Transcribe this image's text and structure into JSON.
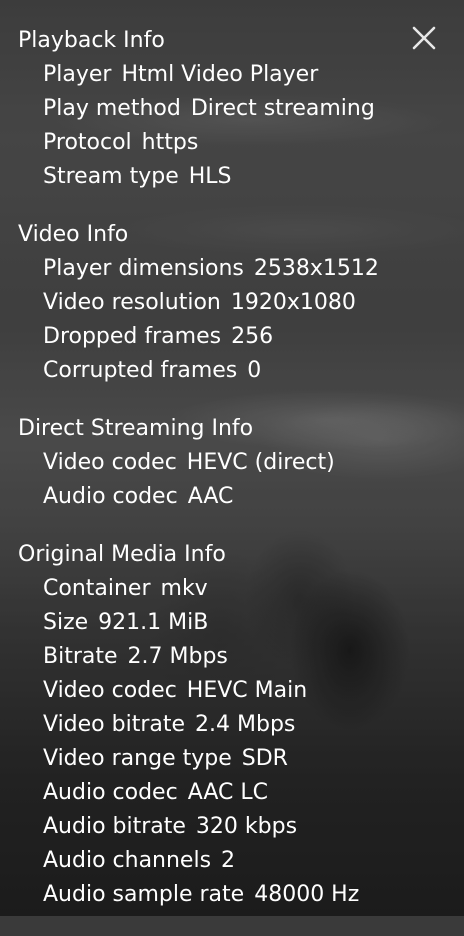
{
  "close_icon": "close-icon",
  "sections": [
    {
      "title": "Playback Info",
      "rows": [
        {
          "label": "Player",
          "value": "Html Video Player"
        },
        {
          "label": "Play method",
          "value": "Direct streaming"
        },
        {
          "label": "Protocol",
          "value": "https"
        },
        {
          "label": "Stream type",
          "value": "HLS"
        }
      ]
    },
    {
      "title": "Video Info",
      "rows": [
        {
          "label": "Player dimensions",
          "value": "2538x1512"
        },
        {
          "label": "Video resolution",
          "value": "1920x1080"
        },
        {
          "label": "Dropped frames",
          "value": "256"
        },
        {
          "label": "Corrupted frames",
          "value": "0"
        }
      ]
    },
    {
      "title": "Direct Streaming Info",
      "rows": [
        {
          "label": "Video codec",
          "value": "HEVC (direct)"
        },
        {
          "label": "Audio codec",
          "value": "AAC"
        }
      ]
    },
    {
      "title": "Original Media Info",
      "rows": [
        {
          "label": "Container",
          "value": "mkv"
        },
        {
          "label": "Size",
          "value": "921.1 MiB"
        },
        {
          "label": "Bitrate",
          "value": "2.7 Mbps"
        },
        {
          "label": "Video codec",
          "value": "HEVC Main"
        },
        {
          "label": "Video bitrate",
          "value": "2.4 Mbps"
        },
        {
          "label": "Video range type",
          "value": "SDR"
        },
        {
          "label": "Audio codec",
          "value": "AAC LC"
        },
        {
          "label": "Audio bitrate",
          "value": "320 kbps"
        },
        {
          "label": "Audio channels",
          "value": "2"
        },
        {
          "label": "Audio sample rate",
          "value": "48000 Hz"
        }
      ]
    }
  ]
}
